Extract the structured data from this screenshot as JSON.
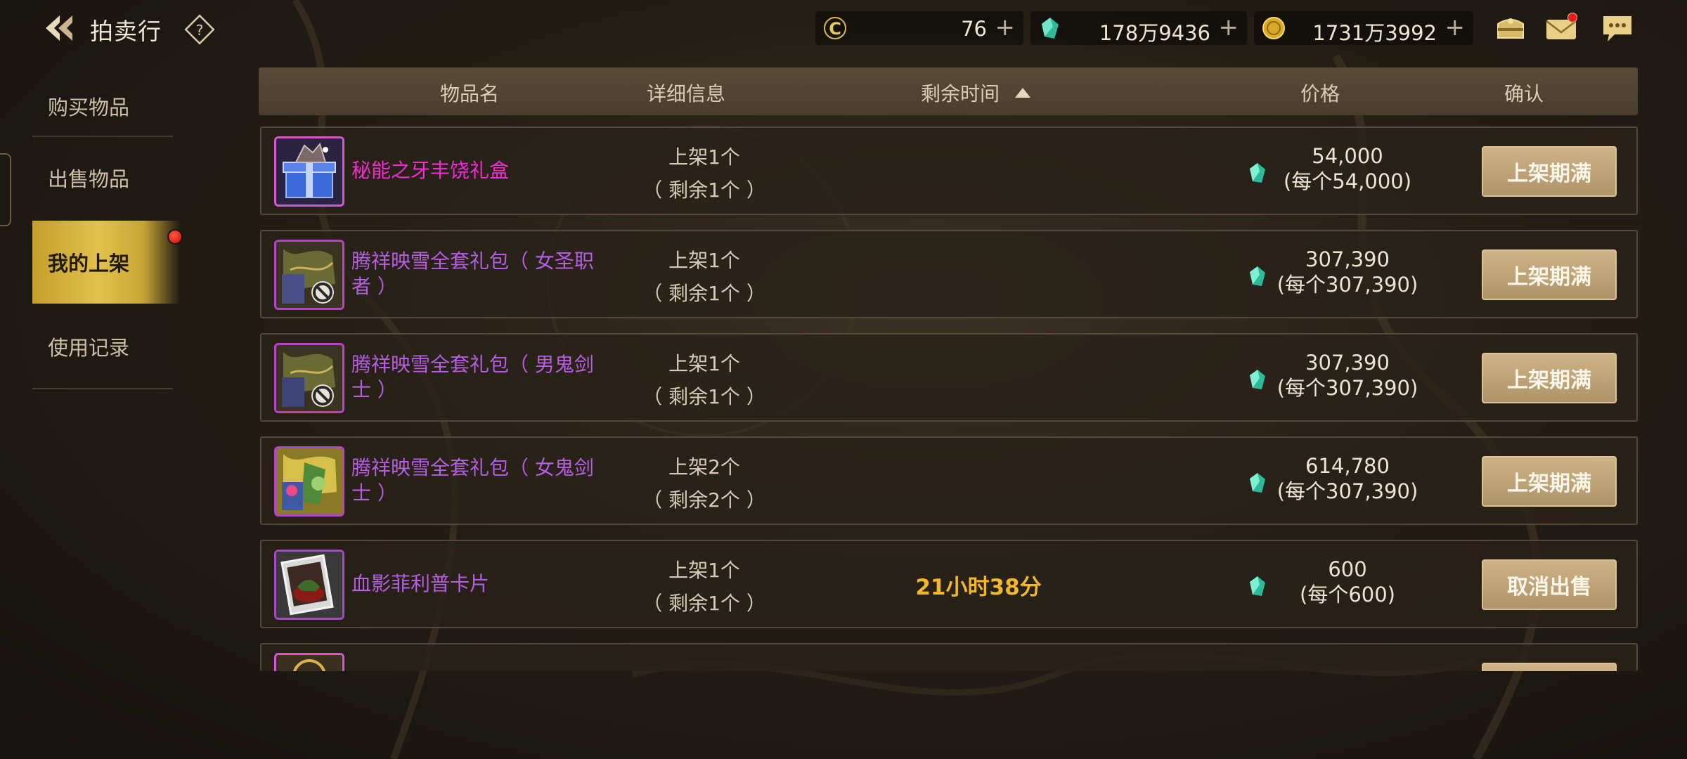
{
  "header": {
    "title": "拍卖行",
    "help_glyph": "?"
  },
  "currencies": [
    {
      "icon": "c-coin-icon",
      "value": "76",
      "plus": "+"
    },
    {
      "icon": "teal-gem-icon",
      "value": "178万9436",
      "plus": "+"
    },
    {
      "icon": "gold-coin-icon",
      "value": "1731万3992",
      "plus": "+"
    }
  ],
  "top_icons": [
    "wallet-icon",
    "mail-icon",
    "chat-icon"
  ],
  "sidebar": {
    "items": [
      {
        "label": "购买物品",
        "active": false
      },
      {
        "label": "出售物品",
        "active": false
      },
      {
        "label": "我的上架",
        "active": true,
        "badge": true
      },
      {
        "label": "使用记录",
        "active": false
      }
    ]
  },
  "table": {
    "columns": [
      "物品名",
      "详细信息",
      "剩余时间",
      "价格",
      "确认"
    ],
    "sort_column": "剩余时间",
    "rows": [
      {
        "name": "秘能之牙丰饶礼盒",
        "name_color": "pink",
        "detail1": "上架1个",
        "detail2": "（ 剩余1个 ）",
        "time": "",
        "price": "54,000",
        "unit": "(每个54,000)",
        "action": "上架期满",
        "icon": "gift-box-icon"
      },
      {
        "name": "腾祥映雪全套礼包（ 女圣职者 ）",
        "name_color": "purple",
        "detail1": "上架1个",
        "detail2": "（ 剩余1个 ）",
        "time": "",
        "price": "307,390",
        "unit": "(每个307,390)",
        "action": "上架期满",
        "icon": "costume-pack-icon"
      },
      {
        "name": "腾祥映雪全套礼包（ 男鬼剑士 ）",
        "name_color": "purple",
        "detail1": "上架1个",
        "detail2": "（ 剩余1个 ）",
        "time": "",
        "price": "307,390",
        "unit": "(每个307,390)",
        "action": "上架期满",
        "icon": "costume-pack-icon"
      },
      {
        "name": "腾祥映雪全套礼包（ 女鬼剑士 ）",
        "name_color": "purple",
        "detail1": "上架2个",
        "detail2": "（ 剩余2个 ）",
        "time": "",
        "price": "614,780",
        "unit": "(每个307,390)",
        "action": "上架期满",
        "icon": "costume-pack-icon"
      },
      {
        "name": "血影菲利普卡片",
        "name_color": "purple",
        "detail1": "上架1个",
        "detail2": "（ 剩余1个 ）",
        "time": "21小时38分",
        "price": "600",
        "unit": "(每个600)",
        "action": "取消出售",
        "icon": "card-icon"
      }
    ]
  },
  "colors": {
    "name_pink": "#f22bd2",
    "name_purple": "#b45ee0",
    "time_gold": "#f0b82a",
    "active_tab_gold": "#e2c14c",
    "button_tan": "#bea376"
  }
}
